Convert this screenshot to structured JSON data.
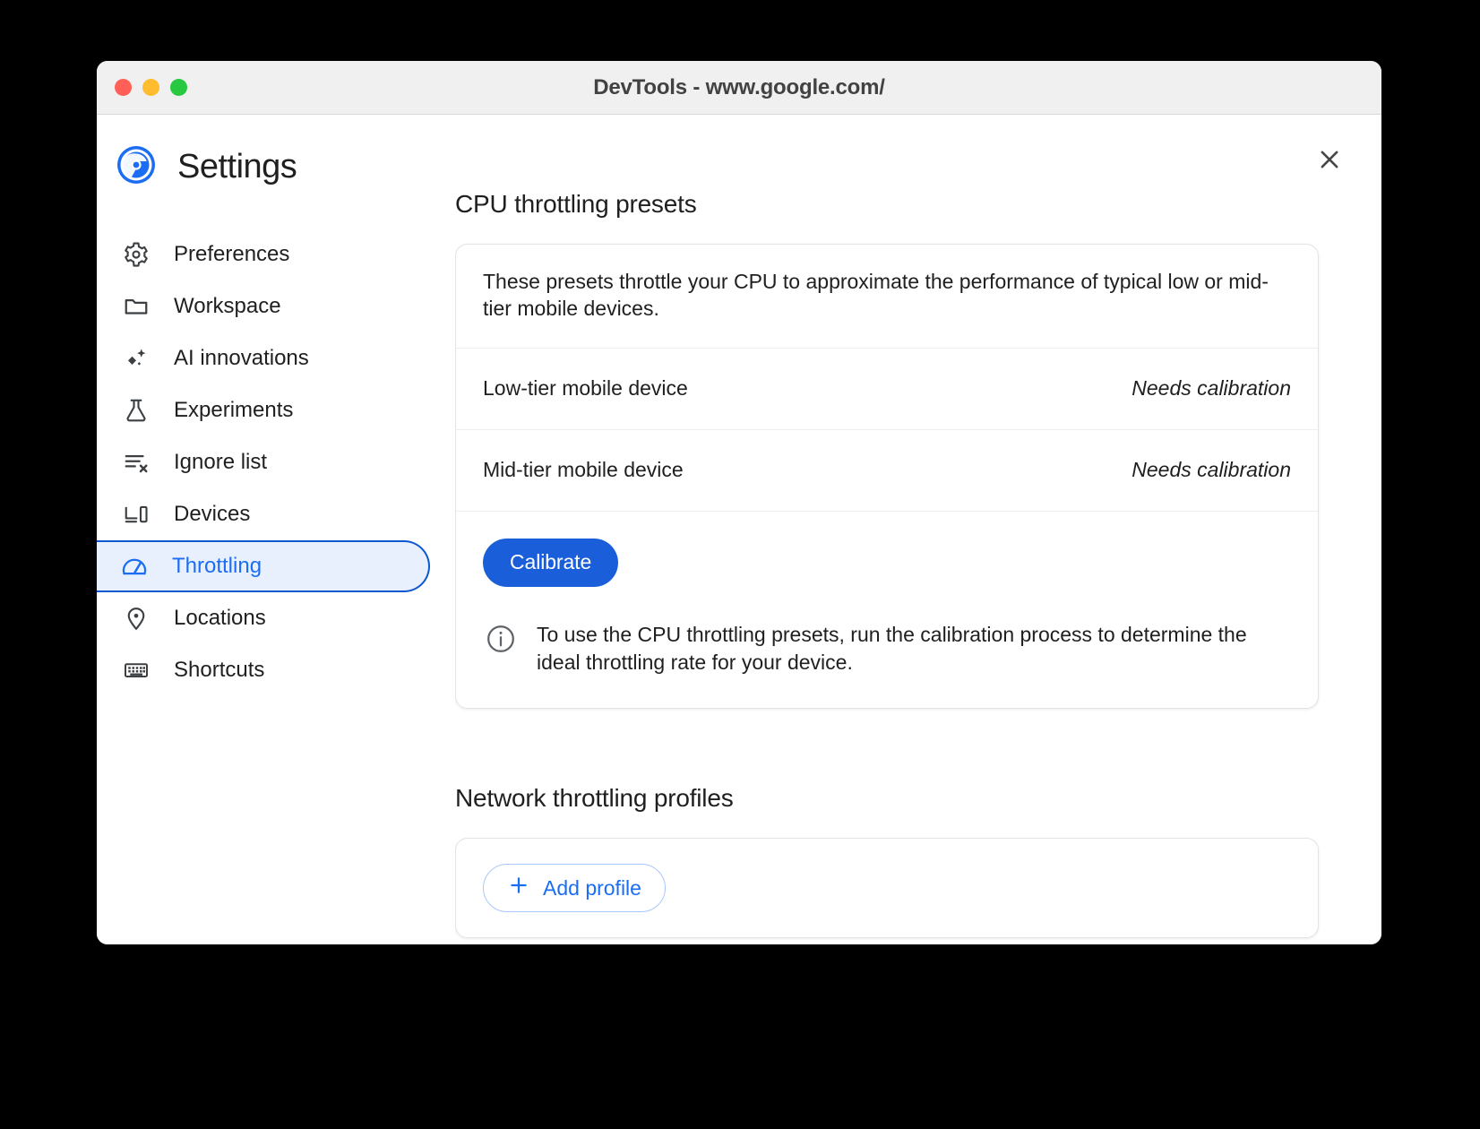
{
  "window": {
    "title": "DevTools - www.google.com/",
    "traffic_lights": [
      "close",
      "minimize",
      "maximize"
    ],
    "close_dialog_label": "Close"
  },
  "sidebar": {
    "logo": "chrome-logo",
    "title": "Settings",
    "items": [
      {
        "label": "Preferences",
        "icon": "gear-icon",
        "selected": false
      },
      {
        "label": "Workspace",
        "icon": "folder-icon",
        "selected": false
      },
      {
        "label": "AI innovations",
        "icon": "sparkle-icon",
        "selected": false
      },
      {
        "label": "Experiments",
        "icon": "flask-icon",
        "selected": false
      },
      {
        "label": "Ignore list",
        "icon": "list-x-icon",
        "selected": false
      },
      {
        "label": "Devices",
        "icon": "devices-icon",
        "selected": false
      },
      {
        "label": "Throttling",
        "icon": "speedometer-icon",
        "selected": true
      },
      {
        "label": "Locations",
        "icon": "map-pin-icon",
        "selected": false
      },
      {
        "label": "Shortcuts",
        "icon": "keyboard-icon",
        "selected": false
      }
    ]
  },
  "main": {
    "cpu_section": {
      "title": "CPU throttling presets",
      "description": "These presets throttle your CPU to approximate the performance of typical low or mid-tier mobile devices.",
      "presets": [
        {
          "name": "Low-tier mobile device",
          "status": "Needs calibration"
        },
        {
          "name": "Mid-tier mobile device",
          "status": "Needs calibration"
        }
      ],
      "calibrate_label": "Calibrate",
      "info_icon": "info-icon",
      "info_text": "To use the CPU throttling presets, run the calibration process to determine the ideal throttling rate for your device."
    },
    "network_section": {
      "title": "Network throttling profiles",
      "add_profile_label": "Add profile",
      "add_profile_icon": "plus-icon"
    }
  },
  "colors": {
    "accent_blue": "#1b6ef3",
    "button_blue": "#1a5fd9",
    "selected_bg": "#e8f0fe",
    "selected_border": "#0b57d0",
    "outline_blue": "#a8c7fa",
    "titlebar_bg": "#f0f0f1",
    "text_primary": "#1f1f1f",
    "light_red": "#ff5f57",
    "light_yellow": "#febc2e",
    "light_green": "#28c840"
  }
}
